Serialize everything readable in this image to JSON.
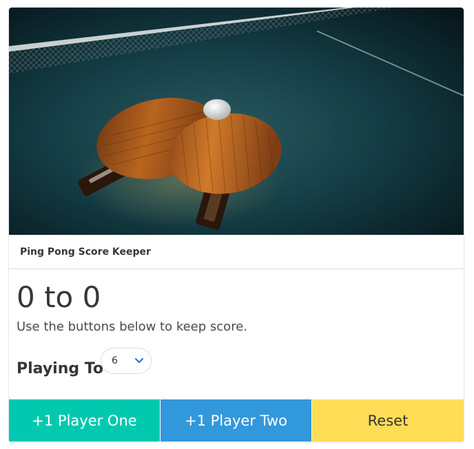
{
  "card": {
    "image_alt": "Ping pong paddles and ball on a table",
    "header_title": "Ping Pong Score Keeper"
  },
  "score": {
    "player_one": 0,
    "player_two": 0,
    "display": "0 to 0",
    "instructions": "Use the buttons below to keep score."
  },
  "playing_to": {
    "label": "Playing To",
    "selected": "6"
  },
  "buttons": {
    "player_one": "+1 Player One",
    "player_two": "+1 Player Two",
    "reset": "Reset"
  },
  "colors": {
    "player_one_button": "#00c9b0",
    "player_two_button": "#3298dc",
    "reset_button": "#ffdd57",
    "select_chevron": "#3273dc"
  },
  "icons": {
    "select_arrow": "chevron-down-icon"
  }
}
